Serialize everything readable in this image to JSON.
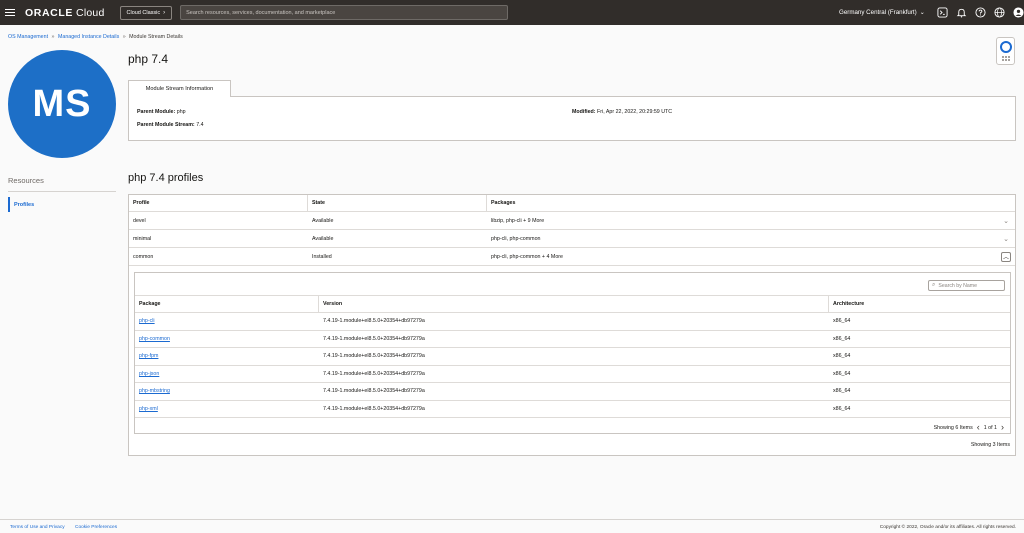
{
  "topbar": {
    "logo_brand": "ORACLE",
    "logo_product": " Cloud",
    "classic_button": "Cloud Classic",
    "search_placeholder": "Search resources, services, documentation, and marketplace",
    "region": "Germany Central (Frankfurt)",
    "icons": [
      "cloud-shell-icon",
      "bell-icon",
      "help-icon",
      "globe-icon",
      "user-icon"
    ]
  },
  "breadcrumb": {
    "items": [
      "OS Management",
      "Managed Instance Details"
    ],
    "current": "Module Stream Details",
    "separator": "»"
  },
  "avatar": {
    "initials": "MS",
    "color": "#1d6fc7"
  },
  "resources": {
    "title": "Resources",
    "items": [
      "Profiles"
    ]
  },
  "page": {
    "title": "php 7.4"
  },
  "info": {
    "tab_label": "Module Stream Information",
    "parent_module_label": "Parent Module:",
    "parent_module_value": "php",
    "parent_stream_label": "Parent Module Stream:",
    "parent_stream_value": "7.4",
    "modified_label": "Modified:",
    "modified_value": "Fri, Apr 22, 2022, 20:29:59 UTC"
  },
  "profiles": {
    "title": "php 7.4 profiles",
    "columns": [
      "Profile",
      "State",
      "Packages"
    ],
    "rows": [
      {
        "profile": "devel",
        "state": "Available",
        "packages": "libzip, php-cli + 9 More"
      },
      {
        "profile": "minimal",
        "state": "Available",
        "packages": "php-cli, php-common"
      },
      {
        "profile": "common",
        "state": "Installed",
        "packages": "php-cli, php-common + 4 More"
      }
    ],
    "showing": "Showing 3 Items"
  },
  "packages": {
    "search_placeholder": "Search by Name",
    "columns": [
      "Package",
      "Version",
      "Architecture"
    ],
    "rows": [
      {
        "package": "php-cli",
        "version": "7.4.19-1.module+el8.5.0+20354+db97279a",
        "arch": "x86_64"
      },
      {
        "package": "php-common",
        "version": "7.4.19-1.module+el8.5.0+20354+db97279a",
        "arch": "x86_64"
      },
      {
        "package": "php-fpm",
        "version": "7.4.19-1.module+el8.5.0+20354+db97279a",
        "arch": "x86_64"
      },
      {
        "package": "php-json",
        "version": "7.4.19-1.module+el8.5.0+20354+db97279a",
        "arch": "x86_64"
      },
      {
        "package": "php-mbstring",
        "version": "7.4.19-1.module+el8.5.0+20354+db97279a",
        "arch": "x86_64"
      },
      {
        "package": "php-xml",
        "version": "7.4.19-1.module+el8.5.0+20354+db97279a",
        "arch": "x86_64"
      }
    ],
    "showing": "Showing 6 Items",
    "page_indicator": "1 of 1"
  },
  "footer": {
    "terms": "Terms of Use and Privacy",
    "cookies": "Cookie Preferences",
    "copyright": "Copyright © 2022, Oracle and/or its affiliates. All rights reserved."
  }
}
